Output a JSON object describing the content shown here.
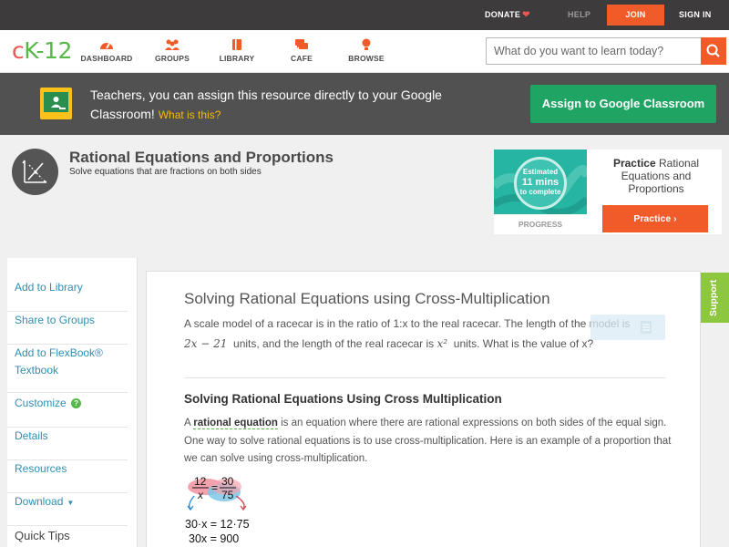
{
  "topbar": {
    "donate": "DONATE",
    "help": "HELP",
    "join": "JOIN",
    "signin": "SIGN IN"
  },
  "nav": {
    "logo": {
      "c": "c",
      "k": "K",
      "rest": "-12"
    },
    "items": [
      {
        "label": "DASHBOARD",
        "icon": "dashboard-icon"
      },
      {
        "label": "GROUPS",
        "icon": "groups-icon"
      },
      {
        "label": "LIBRARY",
        "icon": "library-icon"
      },
      {
        "label": "CAFE",
        "icon": "cafe-icon"
      },
      {
        "label": "BROWSE",
        "icon": "browse-icon"
      }
    ],
    "search_placeholder": "What do you want to learn today?"
  },
  "teacher_banner": {
    "text": "Teachers, you can assign this resource directly to your Google Classroom!",
    "what_link": "What is this?",
    "assign_button": "Assign to Google Classroom"
  },
  "concept": {
    "title": "Rational Equations and Proportions",
    "subtitle": "Solve equations that are fractions on both sides"
  },
  "practice": {
    "estimated": "Estimated",
    "mins": "11 mins",
    "to_complete": "to complete",
    "progress_label": "PROGRESS",
    "title_bold": "Practice",
    "title_rest": "Rational Equations and Proportions",
    "button": "Practice"
  },
  "sidebar": {
    "add_to_library": "Add to Library",
    "share_to_groups": "Share to Groups",
    "add_to_flexbook_1": "Add to FlexBook®",
    "add_to_flexbook_2": "Textbook",
    "customize": "Customize",
    "details": "Details",
    "resources": "Resources",
    "download": "Download",
    "quick_tips": "Quick Tips"
  },
  "main": {
    "question_title": "Solving Rational Equations using Cross-Multiplication",
    "question_line1": "A scale model of a racecar is in the ratio of 1:x to the real racecar. The length of the model is",
    "question_expr": "2x − 21",
    "question_line2": "units, and the length of the real racecar is",
    "question_x2": "x²",
    "question_line3": "units. What is the value of x?",
    "section_title": "Solving Rational Equations Using Cross Multiplication",
    "section_a": "A",
    "section_term": "rational equation",
    "section_text": "is an equation where there are rational expressions on both sides of the equal sign. One way to solve rational equations is to use cross-multiplication. Here is an example of a proportion that we can solve using cross-multiplication.",
    "fraction_left_num": "12",
    "fraction_left_den": "x",
    "fraction_right_num": "30",
    "fraction_right_den": "75",
    "equation_1": "30·x = 12·75",
    "equation_2": "30x = 900"
  },
  "support": "Support"
}
